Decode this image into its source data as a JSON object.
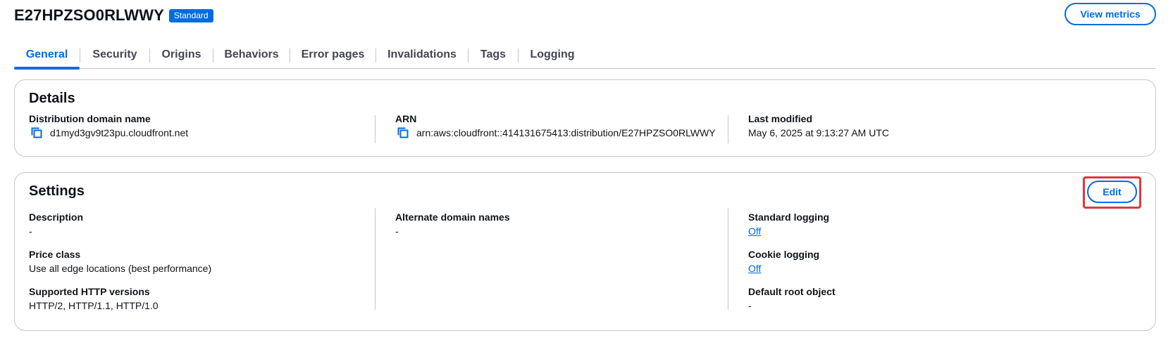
{
  "header": {
    "title": "E27HPZSO0RLWWY",
    "badge": "Standard",
    "view_metrics_label": "View metrics"
  },
  "tabs": [
    {
      "label": "General",
      "active": true
    },
    {
      "label": "Security",
      "active": false
    },
    {
      "label": "Origins",
      "active": false
    },
    {
      "label": "Behaviors",
      "active": false
    },
    {
      "label": "Error pages",
      "active": false
    },
    {
      "label": "Invalidations",
      "active": false
    },
    {
      "label": "Tags",
      "active": false
    },
    {
      "label": "Logging",
      "active": false
    }
  ],
  "details": {
    "title": "Details",
    "items": [
      {
        "label": "Distribution domain name",
        "value": "d1myd3gv9t23pu.cloudfront.net",
        "icon": "copy-icon"
      },
      {
        "label": "ARN",
        "value": "arn:aws:cloudfront::414131675413:distribution/E27HPZSO0RLWWY",
        "icon": "copy-icon"
      },
      {
        "label": "Last modified",
        "value": "May 6, 2025 at 9:13:27 AM UTC"
      }
    ]
  },
  "settings": {
    "title": "Settings",
    "edit_label": "Edit",
    "col1": [
      {
        "label": "Description",
        "value": "-"
      },
      {
        "label": "Price class",
        "value": "Use all edge locations (best performance)"
      },
      {
        "label": "Supported HTTP versions",
        "value": "HTTP/2, HTTP/1.1, HTTP/1.0"
      }
    ],
    "col2": [
      {
        "label": "Alternate domain names",
        "value": "-"
      }
    ],
    "col3": [
      {
        "label": "Standard logging",
        "value": "Off",
        "link": true
      },
      {
        "label": "Cookie logging",
        "value": "Off",
        "link": true
      },
      {
        "label": "Default root object",
        "value": "-"
      }
    ]
  },
  "colors": {
    "accent": "#006ce0",
    "border": "#c6c6cd",
    "highlight": "#e0373d"
  }
}
